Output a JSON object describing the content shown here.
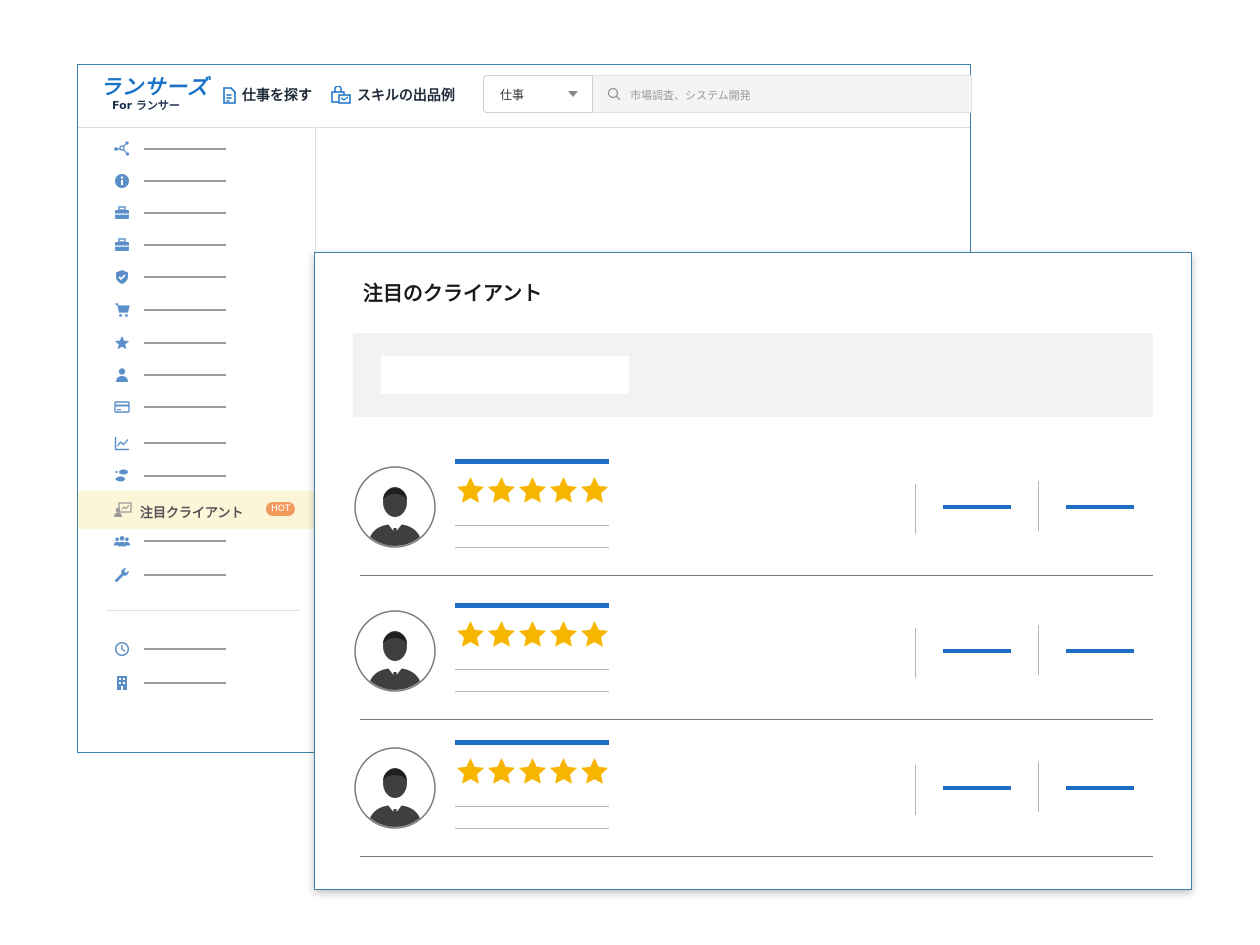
{
  "header": {
    "logo_main": "ランサーズ",
    "logo_sub": "For ランサー",
    "nav": [
      {
        "label": "仕事を探す",
        "icon": "document-icon"
      },
      {
        "label": "スキルの出品例",
        "icon": "shop-bag-icon"
      }
    ],
    "search": {
      "category": "仕事",
      "placeholder": "市場調査、システム開発"
    }
  },
  "sidebar": {
    "items_top": [
      {
        "icon": "network-icon"
      },
      {
        "icon": "info-icon"
      },
      {
        "icon": "briefcase-icon"
      },
      {
        "icon": "briefcase-icon"
      },
      {
        "icon": "shield-check-icon"
      },
      {
        "icon": "cart-icon"
      },
      {
        "icon": "star-icon"
      },
      {
        "icon": "person-icon"
      },
      {
        "icon": "card-icon"
      },
      {
        "icon": "chart-icon"
      },
      {
        "icon": "footprint-icon"
      }
    ],
    "featured": {
      "label": "注目クライアント",
      "badge": "HOT",
      "icon": "client-icon"
    },
    "items_bottom": [
      {
        "icon": "group-icon"
      },
      {
        "icon": "wrench-icon"
      }
    ],
    "items_footer": [
      {
        "icon": "clock-icon"
      },
      {
        "icon": "building-icon"
      }
    ]
  },
  "panel": {
    "title": "注目のクライアント",
    "clients": [
      {
        "rating": 5
      },
      {
        "rating": 5
      },
      {
        "rating": 5
      }
    ]
  },
  "colors": {
    "brand": "#1a73c8",
    "star": "#f7b500",
    "hot_badge": "#f19a5d",
    "highlight_bg": "#fdf5d8"
  }
}
